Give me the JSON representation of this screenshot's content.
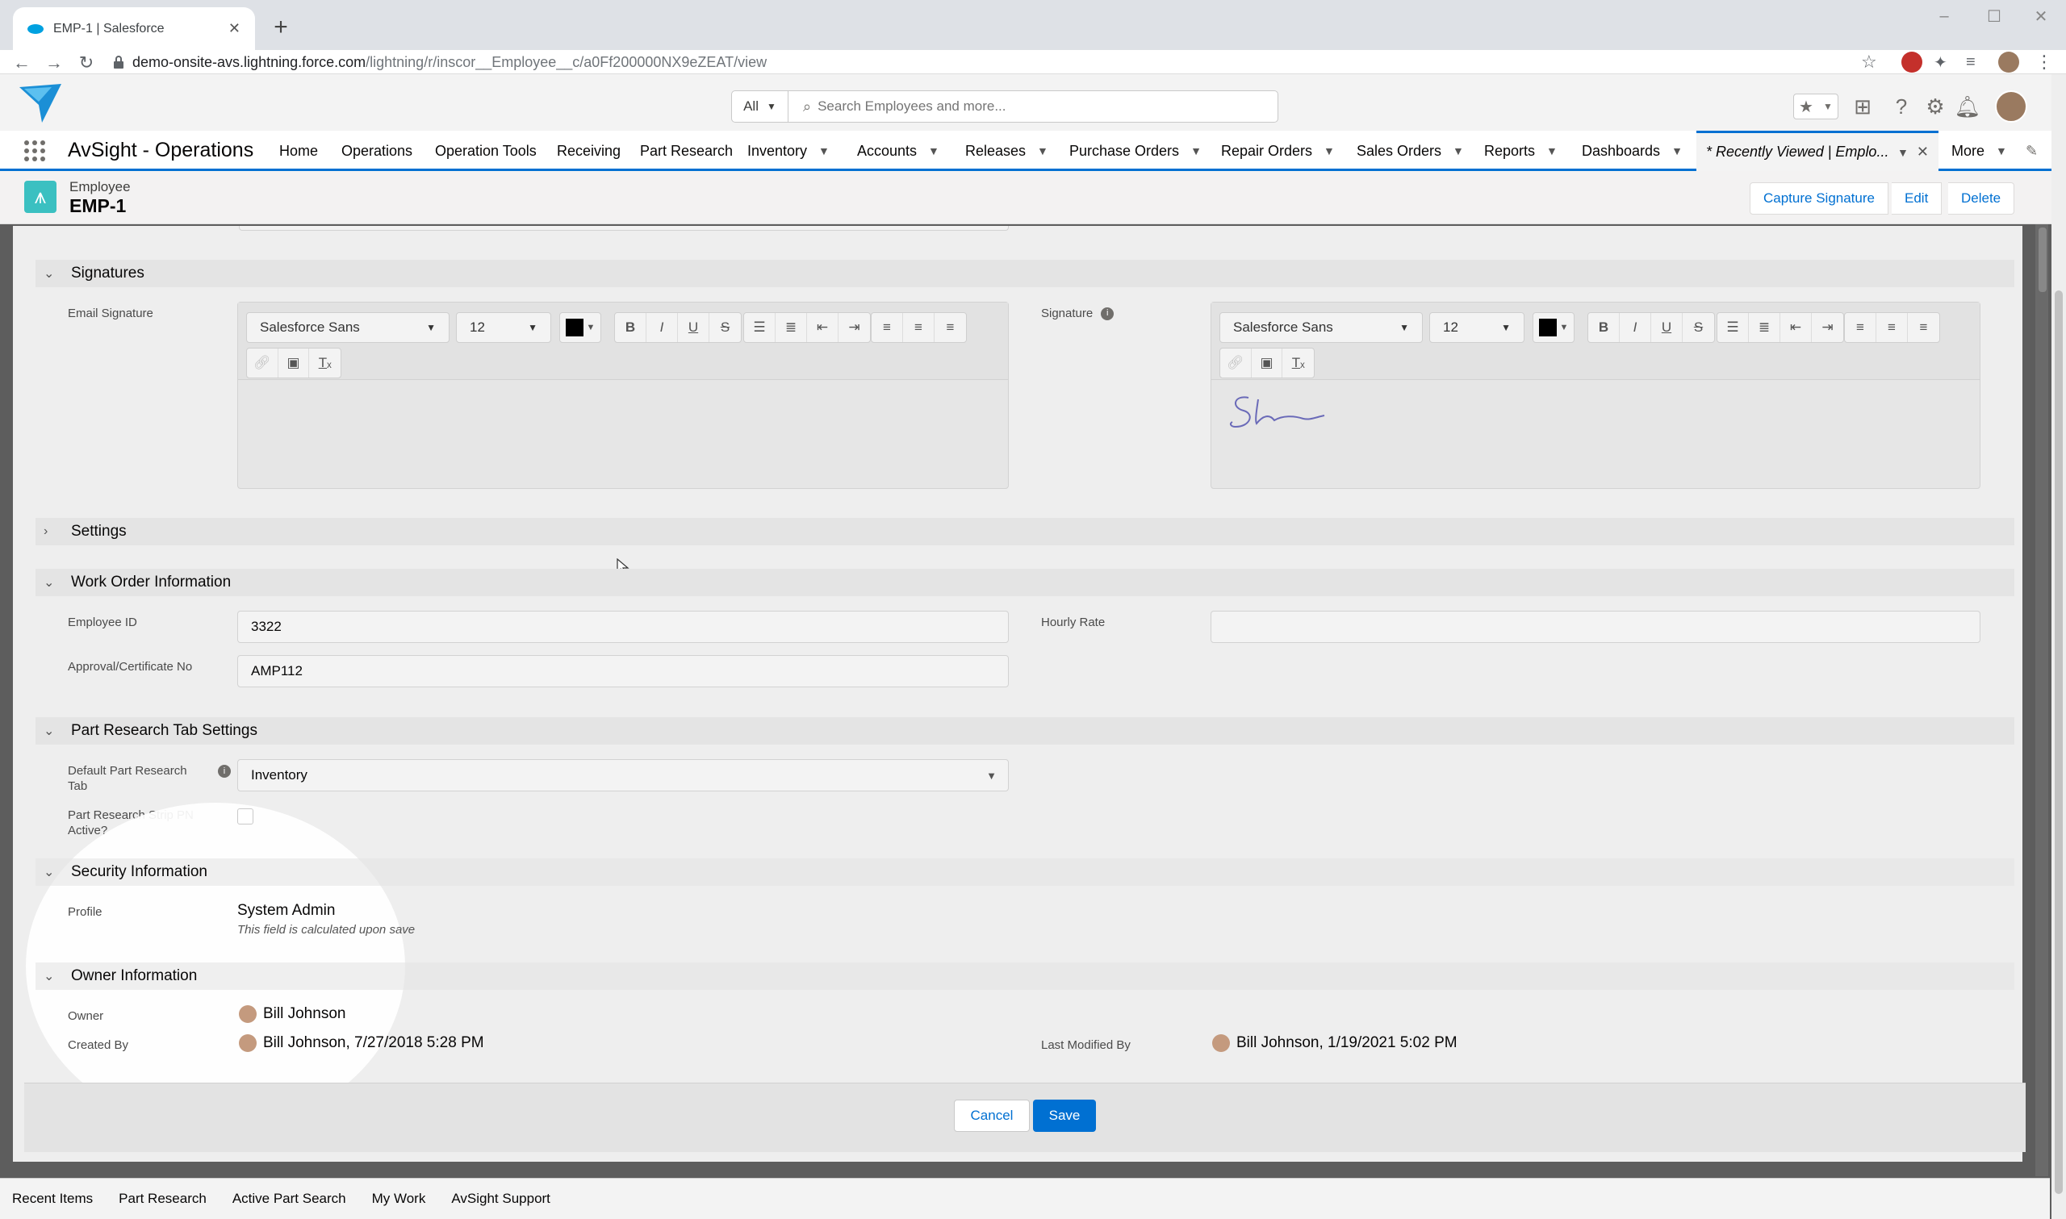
{
  "browser": {
    "tab_title": "EMP-1 | Salesforce",
    "url_host": "demo-onsite-avs.lightning.force.com",
    "url_path": "/lightning/r/inscor__Employee__c/a0Ff200000NX9eZEAT/view"
  },
  "header": {
    "search_scope": "All",
    "search_placeholder": "Search Employees and more..."
  },
  "nav": {
    "app_name": "AvSight - Operations",
    "items": [
      {
        "label": "Home"
      },
      {
        "label": "Operations"
      },
      {
        "label": "Operation Tools"
      },
      {
        "label": "Receiving"
      },
      {
        "label": "Part Research"
      },
      {
        "label": "Inventory"
      },
      {
        "label": "Accounts"
      },
      {
        "label": "Releases"
      },
      {
        "label": "Purchase Orders"
      },
      {
        "label": "Repair Orders"
      },
      {
        "label": "Sales Orders"
      },
      {
        "label": "Reports"
      },
      {
        "label": "Dashboards"
      }
    ],
    "active_tab": "* Recently Viewed | Emplo...",
    "more": "More"
  },
  "record": {
    "object_label": "Employee",
    "name": "EMP-1",
    "actions": {
      "capture_signature": "Capture Signature",
      "edit": "Edit",
      "delete": "Delete"
    }
  },
  "sections": {
    "signatures": {
      "title": "Signatures",
      "email_signature_label": "Email Signature",
      "signature_label": "Signature",
      "font_family": "Salesforce Sans",
      "font_size": "12"
    },
    "settings": {
      "title": "Settings"
    },
    "work_order": {
      "title": "Work Order Information",
      "employee_id_label": "Employee ID",
      "employee_id_value": "3322",
      "hourly_rate_label": "Hourly Rate",
      "hourly_rate_value": "",
      "approval_label": "Approval/Certificate No",
      "approval_value": "AMP112"
    },
    "part_research": {
      "title": "Part Research Tab Settings",
      "default_tab_label_1": "Default Part Research",
      "default_tab_label_2": "Tab",
      "default_tab_value": "Inventory",
      "strip_pn_label_1": "Part Research Strip PN",
      "strip_pn_label_2": "Active?",
      "strip_pn_checked": false
    },
    "security": {
      "title": "Security Information",
      "profile_label": "Profile",
      "profile_value": "System Admin",
      "profile_note": "This field is calculated upon save"
    },
    "owner": {
      "title": "Owner Information",
      "owner_label": "Owner",
      "owner_value": "Bill Johnson",
      "created_by_label": "Created By",
      "created_by_value": "Bill Johnson, 7/27/2018 5:28 PM",
      "last_modified_label": "Last Modified By",
      "last_modified_value": "Bill Johnson, 1/19/2021 5:02 PM"
    }
  },
  "footer": {
    "cancel": "Cancel",
    "save": "Save"
  },
  "utility_bar": [
    "Recent Items",
    "Part Research",
    "Active Part Search",
    "My Work",
    "AvSight Support"
  ],
  "colors": {
    "brand": "#0070d2",
    "record_icon": "#3bc0c1"
  }
}
